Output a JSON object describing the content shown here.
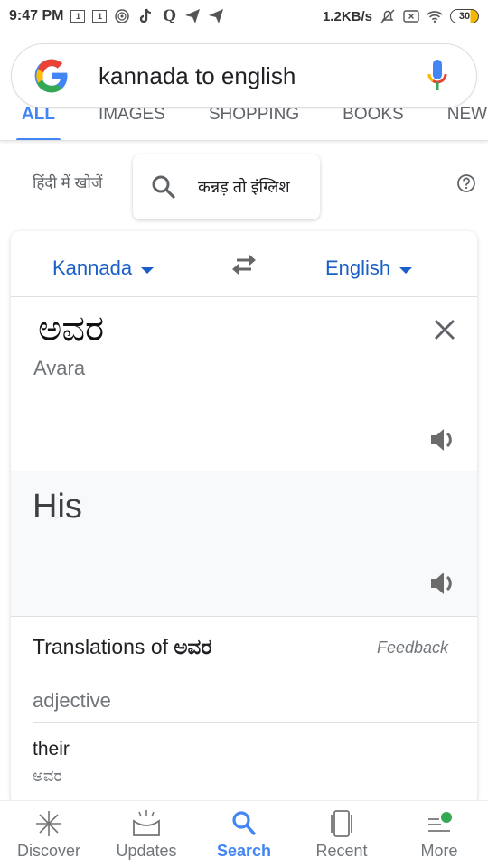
{
  "status_bar": {
    "time": "9:47 PM",
    "notif_icons": [
      "calendar-1-icon",
      "calendar-1-icon",
      "music-disc-icon",
      "tiktok-icon",
      "q-app-icon",
      "telegram-icon",
      "telegram-icon"
    ],
    "calendar_day": "1",
    "net_speed": "1.2KB/s",
    "battery": "30"
  },
  "search": {
    "query": "kannada to english"
  },
  "tabs": [
    {
      "label": "ALL",
      "active": true
    },
    {
      "label": "IMAGES",
      "active": false
    },
    {
      "label": "SHOPPING",
      "active": false
    },
    {
      "label": "BOOKS",
      "active": false
    },
    {
      "label": "NEWS",
      "active": false
    }
  ],
  "hindi_suggest": {
    "label": "हिंदी में खोजें",
    "chip_text": "कन्नड़ तो इंग्लिश"
  },
  "translate": {
    "source_lang": "Kannada",
    "target_lang": "English",
    "source_text": "ಅವರ",
    "source_translit": "Avara",
    "target_text": "His",
    "translations_title": "Translations of",
    "translations_word": "ಅವರ",
    "feedback_label": "Feedback",
    "part_of_speech": "adjective",
    "entries": [
      {
        "word": "their",
        "back": "ಅವರ"
      }
    ]
  },
  "bottom_nav": [
    {
      "label": "Discover",
      "icon": "discover-icon",
      "active": false
    },
    {
      "label": "Updates",
      "icon": "updates-icon",
      "active": false
    },
    {
      "label": "Search",
      "icon": "search-icon",
      "active": true
    },
    {
      "label": "Recent",
      "icon": "recent-icon",
      "active": false
    },
    {
      "label": "More",
      "icon": "more-icon",
      "active": false
    }
  ],
  "colors": {
    "accent_blue": "#4285f4",
    "lang_blue": "#1a5fc8",
    "notification_dot": "#34a853"
  }
}
